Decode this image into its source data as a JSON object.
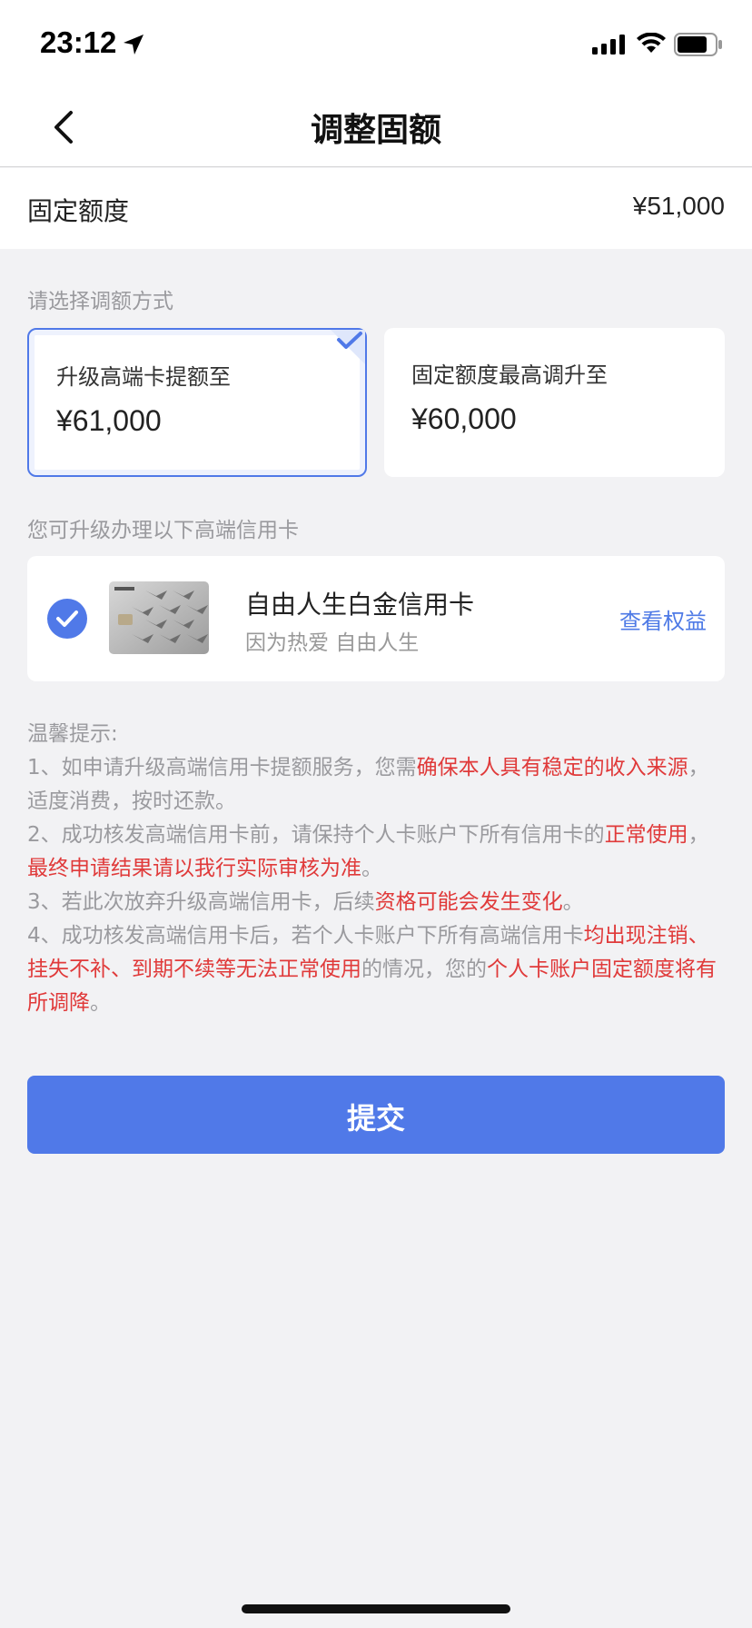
{
  "status_bar": {
    "time": "23:12"
  },
  "nav": {
    "title": "调整固额"
  },
  "fixed_limit": {
    "label": "固定额度",
    "value": "¥51,000"
  },
  "adjust_section": {
    "label": "请选择调额方式"
  },
  "options": [
    {
      "title": "升级高端卡提额至",
      "amount": "¥61,000",
      "selected": true
    },
    {
      "title": "固定额度最高调升至",
      "amount": "¥60,000",
      "selected": false
    }
  ],
  "upgrade_section": {
    "label": "您可升级办理以下高端信用卡"
  },
  "card": {
    "name": "自由人生白金信用卡",
    "slogan": "因为热爱 自由人生",
    "benefits_link": "查看权益",
    "selected": true
  },
  "tips": {
    "heading": "温馨提示:",
    "items": [
      {
        "segments": [
          {
            "text": "1、如申请升级高端信用卡提额服务，您需",
            "highlight": false
          },
          {
            "text": "确保本人具有稳定的收入来源",
            "highlight": true
          },
          {
            "text": "，适度消费，按时还款。",
            "highlight": false
          }
        ]
      },
      {
        "segments": [
          {
            "text": "2、成功核发高端信用卡前，请保持个人卡账户下所有信用卡的",
            "highlight": false
          },
          {
            "text": "正常使用",
            "highlight": true
          },
          {
            "text": "，",
            "highlight": false
          },
          {
            "text": "最终申请结果请以我行实际审核为准",
            "highlight": true
          },
          {
            "text": "。",
            "highlight": false
          }
        ]
      },
      {
        "segments": [
          {
            "text": "3、若此次放弃升级高端信用卡，后续",
            "highlight": false
          },
          {
            "text": "资格可能会发生变化",
            "highlight": true
          },
          {
            "text": "。",
            "highlight": false
          }
        ]
      },
      {
        "segments": [
          {
            "text": "4、成功核发高端信用卡后，若个人卡账户下所有高端信用卡",
            "highlight": false
          },
          {
            "text": "均出现注销、挂失不补、到期不续等无法正常使用",
            "highlight": true
          },
          {
            "text": "的情况，您的",
            "highlight": false
          },
          {
            "text": "个人卡账户固定额度将有所调降",
            "highlight": true
          },
          {
            "text": "。",
            "highlight": false
          }
        ]
      }
    ]
  },
  "submit": {
    "label": "提交"
  },
  "colors": {
    "accent": "#5079e8",
    "highlight": "#e03a3a",
    "link": "#4e7ae6"
  }
}
